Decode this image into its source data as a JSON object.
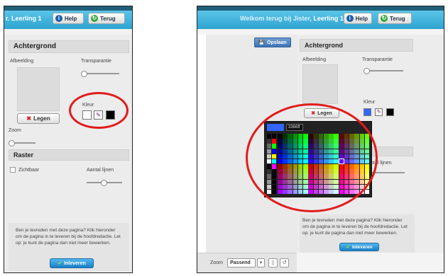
{
  "left": {
    "user_label": "r. Leerling 1",
    "help_label": "Help",
    "back_label": "Terug",
    "background_title": "Achtergrond",
    "image_label": "Afbeelding",
    "transparency_label": "Transparantie",
    "color_label": "Kleur",
    "clear_label": "Legen",
    "zoom_label": "Zoom",
    "grid_title": "Raster",
    "visible_label": "Zichtbaar",
    "lines_label": "Aantal lijnen",
    "info_text": "Ben je tevreden met deze pagina? Klik hieronder om de pagina in te leveren bij de hoofdredactie. Let op: je kunt de pagina dan niet meer bewerken.",
    "submit_label": "Inleveren"
  },
  "right": {
    "welcome_text": "Welkom terug bij Jister,",
    "user_label": "Leerling 1",
    "help_label": "Help",
    "back_label": "Terug",
    "save_label": "Opslaan",
    "background_title": "Achtergrond",
    "image_label": "Afbeelding",
    "transparency_label": "Transparantie",
    "color_label": "Kleur",
    "clear_label": "Legen",
    "lines_label": "ntal lijnen",
    "hex_value": "3366ff",
    "info_text": "Ben je tevreden met deze pagina? Klik hieronder om de pagina in te leveren bij de hoofdredactie. Let op: je kunt de pagina dan niet meer bewerken.",
    "submit_label": "Inleveren",
    "zoom_label": "Zoom",
    "zoom_value": "Passend"
  },
  "colors": {
    "header": "#2ea3cf",
    "highlight_ring": "#e21b1b",
    "selected_color": "#3366ff"
  },
  "icons": [
    "help-icon",
    "back-icon",
    "clear-icon",
    "eyedropper-icon",
    "save-icon",
    "submit-check-icon",
    "dropdown-arrow-icon",
    "page-icon",
    "rotate-icon"
  ]
}
